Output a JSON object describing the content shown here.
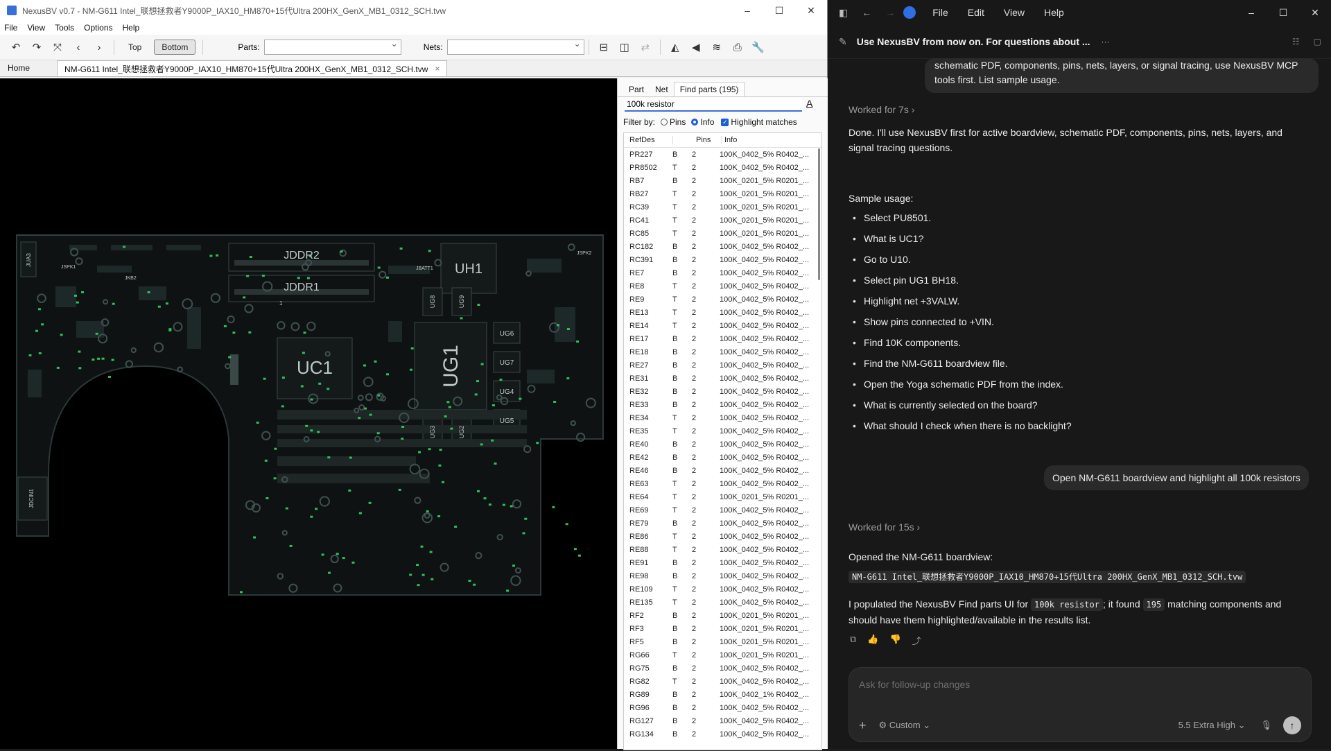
{
  "left_window": {
    "title": "NexusBV v0.7 - NM-G611 Intel_联想拯救者Y9000P_IAX10_HM870+15代Ultra 200HX_GenX_MB1_0312_SCH.tvw",
    "menu": [
      "File",
      "View",
      "Tools",
      "Options",
      "Help"
    ],
    "toolbar": {
      "top_label": "Top",
      "bottom_label": "Bottom",
      "parts_label": "Parts:",
      "parts_value": "",
      "nets_label": "Nets:",
      "nets_value": ""
    },
    "tabs": {
      "home": "Home",
      "file_tab": "NM-G611 Intel_联想拯救者Y9000P_IAX10_HM870+15代Ultra 200HX_GenX_MB1_0312_SCH.tvw"
    },
    "board_labels": {
      "uc1": "UC1",
      "ug1": "UG1",
      "uh1": "UH1",
      "ddr2": "JDDR2",
      "ddr1": "JDDR1",
      "ug6": "UG6",
      "ug7": "UG7",
      "ug4": "UG4",
      "ug5": "UG5",
      "ug8": "UG8",
      "ug9": "UG9",
      "ug3": "UG3",
      "ug2": "UG2",
      "jua3": "JUA3",
      "jspk1": "JSPK1",
      "jkb2": "JKB2",
      "jbatt1": "JBATT1",
      "jspk2": "JSPK2",
      "jdcin1": "JDCIN1",
      "one": "1"
    },
    "panel": {
      "tab_part": "Part",
      "tab_net": "Net",
      "tab_find": "Find parts (195)",
      "search_value": "100k resistor",
      "font_button": "A",
      "filter_label": "Filter by:",
      "filter_pins": "Pins",
      "filter_info": "Info",
      "highlight_label": "Highlight matches",
      "columns": [
        "RefDes",
        "Pins",
        "Info"
      ],
      "rows": [
        [
          "PR227",
          "B",
          "2",
          "100K_0402_5% R0402_..."
        ],
        [
          "PR8502",
          "T",
          "2",
          "100K_0402_5% R0402_..."
        ],
        [
          "RB7",
          "B",
          "2",
          "100K_0201_5% R0201_..."
        ],
        [
          "RB27",
          "T",
          "2",
          "100K_0201_5% R0201_..."
        ],
        [
          "RC39",
          "T",
          "2",
          "100K_0201_5% R0201_..."
        ],
        [
          "RC41",
          "T",
          "2",
          "100K_0201_5% R0201_..."
        ],
        [
          "RC85",
          "T",
          "2",
          "100K_0201_5% R0201_..."
        ],
        [
          "RC182",
          "B",
          "2",
          "100K_0402_5% R0402_..."
        ],
        [
          "RC391",
          "B",
          "2",
          "100K_0402_5% R0402_..."
        ],
        [
          "RE7",
          "B",
          "2",
          "100K_0402_5% R0402_..."
        ],
        [
          "RE8",
          "T",
          "2",
          "100K_0402_5% R0402_..."
        ],
        [
          "RE9",
          "T",
          "2",
          "100K_0402_5% R0402_..."
        ],
        [
          "RE13",
          "T",
          "2",
          "100K_0402_5% R0402_..."
        ],
        [
          "RE14",
          "T",
          "2",
          "100K_0402_5% R0402_..."
        ],
        [
          "RE17",
          "B",
          "2",
          "100K_0402_5% R0402_..."
        ],
        [
          "RE18",
          "B",
          "2",
          "100K_0402_5% R0402_..."
        ],
        [
          "RE27",
          "B",
          "2",
          "100K_0402_5% R0402_..."
        ],
        [
          "RE31",
          "B",
          "2",
          "100K_0402_5% R0402_..."
        ],
        [
          "RE32",
          "B",
          "2",
          "100K_0402_5% R0402_..."
        ],
        [
          "RE33",
          "B",
          "2",
          "100K_0402_5% R0402_..."
        ],
        [
          "RE34",
          "T",
          "2",
          "100K_0402_5% R0402_..."
        ],
        [
          "RE35",
          "T",
          "2",
          "100K_0402_5% R0402_..."
        ],
        [
          "RE40",
          "B",
          "2",
          "100K_0402_5% R0402_..."
        ],
        [
          "RE42",
          "B",
          "2",
          "100K_0402_5% R0402_..."
        ],
        [
          "RE46",
          "B",
          "2",
          "100K_0402_5% R0402_..."
        ],
        [
          "RE63",
          "T",
          "2",
          "100K_0402_5% R0402_..."
        ],
        [
          "RE64",
          "T",
          "2",
          "100K_0201_5% R0201_..."
        ],
        [
          "RE69",
          "T",
          "2",
          "100K_0402_5% R0402_..."
        ],
        [
          "RE79",
          "B",
          "2",
          "100K_0402_5% R0402_..."
        ],
        [
          "RE86",
          "T",
          "2",
          "100K_0402_5% R0402_..."
        ],
        [
          "RE88",
          "T",
          "2",
          "100K_0402_5% R0402_..."
        ],
        [
          "RE91",
          "B",
          "2",
          "100K_0402_5% R0402_..."
        ],
        [
          "RE98",
          "B",
          "2",
          "100K_0402_5% R0402_..."
        ],
        [
          "RE109",
          "T",
          "2",
          "100K_0402_5% R0402_..."
        ],
        [
          "RE135",
          "T",
          "2",
          "100K_0402_5% R0402_..."
        ],
        [
          "RF2",
          "B",
          "2",
          "100K_0201_5% R0201_..."
        ],
        [
          "RF3",
          "B",
          "2",
          "100K_0201_5% R0201_..."
        ],
        [
          "RF5",
          "B",
          "2",
          "100K_0201_5% R0201_..."
        ],
        [
          "RG66",
          "T",
          "2",
          "100K_0201_5% R0201_..."
        ],
        [
          "RG75",
          "B",
          "2",
          "100K_0402_5% R0402_..."
        ],
        [
          "RG82",
          "T",
          "2",
          "100K_0402_5% R0402_..."
        ],
        [
          "RG89",
          "B",
          "2",
          "100K_0402_1% R0402_..."
        ],
        [
          "RG96",
          "B",
          "2",
          "100K_0402_5% R0402_..."
        ],
        [
          "RG127",
          "B",
          "2",
          "100K_0402_5% R0402_..."
        ],
        [
          "RG134",
          "B",
          "2",
          "100K_0402_5% R0402_..."
        ]
      ]
    }
  },
  "right_window": {
    "menu": [
      "File",
      "Edit",
      "View",
      "Help"
    ],
    "thread_title": "Use NexusBV from now on. For questions about ...",
    "user_msg1": "schematic PDF, components, pins, nets, layers, or signal tracing, use NexusBV MCP tools first. List sample usage.",
    "worked1": "Worked for 7s",
    "reply1": "Done. I'll use NexusBV first for active boardview, schematic PDF, components, pins, nets, layers, and signal tracing questions.",
    "sample_usage": "Sample usage:",
    "bullets": [
      "Select PU8501.",
      "What is UC1?",
      "Go to U10.",
      "Select pin UG1 BH18.",
      "Highlight net +3VALW.",
      "Show pins connected to +VIN.",
      "Find 10K components.",
      "Find the NM-G611 boardview file.",
      "Open the Yoga schematic PDF from the index.",
      "What is currently selected on the board?",
      "What should I check when there is no backlight?"
    ],
    "user_msg2": "Open NM-G611 boardview and highlight all 100k resistors",
    "worked2": "Worked for 15s",
    "reply2_intro": "Opened the NM-G611 boardview:",
    "reply2_code": "NM-G611 Intel_联想拯救者Y9000P_IAX10_HM870+15代Ultra 200HX_GenX_MB1_0312_SCH.tvw",
    "reply2_a": "I populated the NexusBV Find parts UI for",
    "reply2_query": "100k resistor",
    "reply2_b": "; it found",
    "reply2_count": "195",
    "reply2_c": "matching components and",
    "reply2_d": "should have them highlighted/available in the results list.",
    "composer_placeholder": "Ask for follow-up changes",
    "mode": "Custom",
    "model": "5.5",
    "effort": "Extra High"
  },
  "colors": {
    "accent": "#3a6fd8",
    "board_bg": "#000000",
    "pcb": "#0f1212",
    "chat_bg": "#181818"
  }
}
